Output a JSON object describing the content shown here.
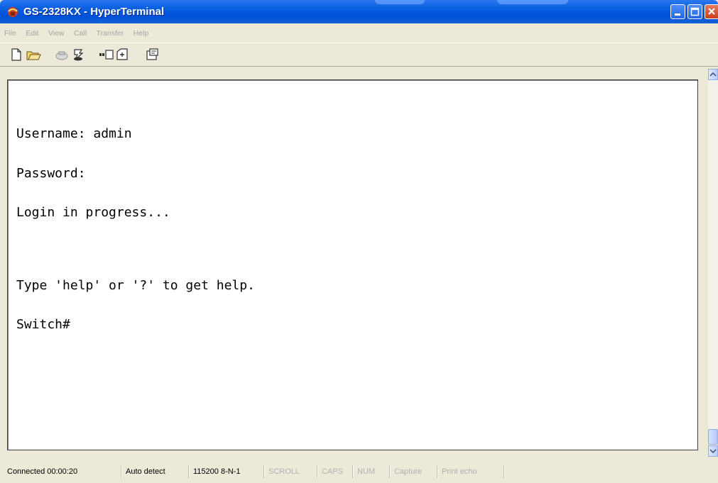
{
  "window": {
    "title": "GS-2328KX - HyperTerminal",
    "app_icon": "hyperterminal-icon",
    "controls": [
      "minimize-icon",
      "maximize-icon",
      "close-icon"
    ]
  },
  "menu": {
    "items": [
      {
        "label": "File"
      },
      {
        "label": "Edit"
      },
      {
        "label": "View"
      },
      {
        "label": "Call"
      },
      {
        "label": "Transfer"
      },
      {
        "label": "Help"
      }
    ]
  },
  "toolbar": {
    "buttons": [
      "new-file-icon",
      "open-folder-icon",
      "call-icon",
      "disconnect-icon",
      "send-icon",
      "receive-icon",
      "properties-icon"
    ]
  },
  "terminal": {
    "lines": [
      "Username: admin",
      "Password:",
      "Login in progress...",
      "",
      "Type 'help' or '?' to get help.",
      "Switch#"
    ]
  },
  "status": {
    "connected": "Connected 00:00:20",
    "detect": "Auto detect",
    "settings": "115200 8-N-1",
    "scroll": "SCROLL",
    "caps": "CAPS",
    "num": "NUM",
    "capture": "Capture",
    "print_echo": "Print echo"
  },
  "colors": {
    "titlebar": "#0054E3",
    "chrome": "#ECE9D8",
    "terminal_bg": "#FFFFFF",
    "terminal_text": "#000000"
  }
}
